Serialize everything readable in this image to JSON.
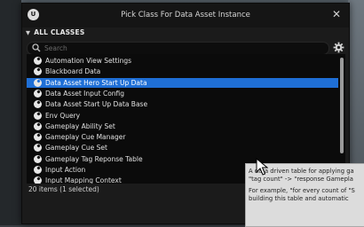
{
  "window": {
    "title": "Pick Class For Data Asset Instance",
    "close_glyph": "✕",
    "logo_text": "U"
  },
  "section": {
    "label": "ALL CLASSES"
  },
  "search": {
    "placeholder": "Search",
    "value": ""
  },
  "list": {
    "selected_index": 2,
    "items": [
      {
        "label": "Automation View Settings"
      },
      {
        "label": "Blackboard Data"
      },
      {
        "label": "Data Asset Hero Start Up Data"
      },
      {
        "label": "Data Asset Input Config"
      },
      {
        "label": "Data Asset Start Up Data Base"
      },
      {
        "label": "Env Query"
      },
      {
        "label": "Gameplay Ability Set"
      },
      {
        "label": "Gameplay Cue Manager"
      },
      {
        "label": "Gameplay Cue Set"
      },
      {
        "label": "Gameplay Tag Reponse Table"
      },
      {
        "label": "Input Action"
      },
      {
        "label": "Input Mapping Context"
      }
    ]
  },
  "status": {
    "text": "20 items (1 selected)"
  },
  "tooltip": {
    "line1": "A data driven table for applying ga",
    "line2": "\"tag count\" -> \"response Gamepla",
    "line3": "For example, \"for every count of \"S",
    "line4": "building this table and automatic"
  },
  "colors": {
    "selection": "#1f6fd6",
    "list_bg": "#0b0b0b",
    "titlebar": "#151515"
  }
}
